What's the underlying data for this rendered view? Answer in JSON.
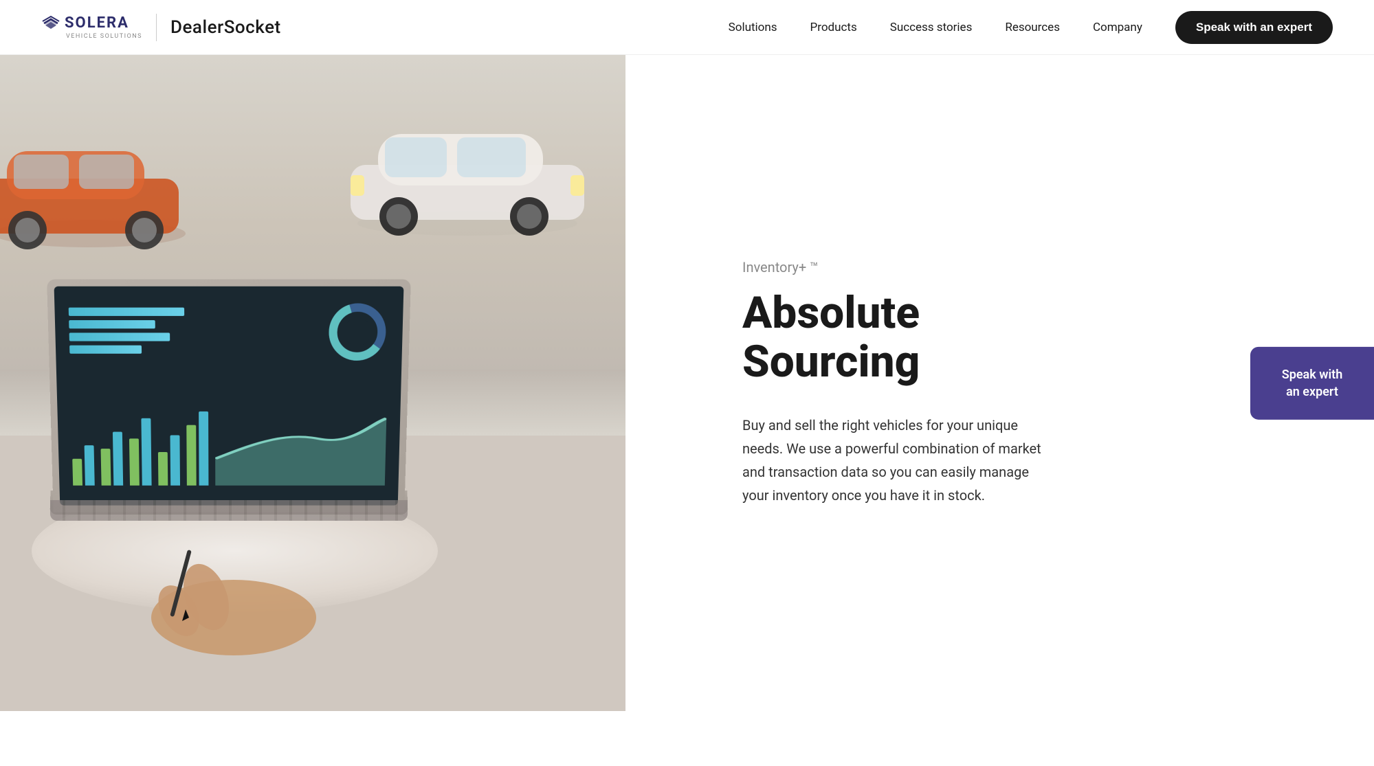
{
  "header": {
    "logo": {
      "solera_name": "SOLERA",
      "solera_subtitle": "Vehicle Solutions",
      "divider": "|",
      "dealersocket_name": "DealerSocket"
    },
    "nav": {
      "items": [
        {
          "id": "solutions",
          "label": "Solutions"
        },
        {
          "id": "products",
          "label": "Products"
        },
        {
          "id": "success-stories",
          "label": "Success stories"
        },
        {
          "id": "resources",
          "label": "Resources"
        },
        {
          "id": "company",
          "label": "Company"
        }
      ],
      "cta_label": "Speak with an expert"
    }
  },
  "hero": {
    "product_tag": "Inventory+ ™",
    "title": "Absolute Sourcing",
    "description": "Buy and sell the right vehicles for your unique needs. We use a powerful combination of market and transaction data so you can easily manage your inventory once you have it in stock.",
    "floating_cta_line1": "Speak with",
    "floating_cta_line2": "an expert"
  },
  "colors": {
    "primary_dark": "#1a1a1a",
    "purple": "#4a3f8f",
    "nav_text": "#1a1a1a",
    "tag_color": "#888888",
    "desc_color": "#333333"
  }
}
